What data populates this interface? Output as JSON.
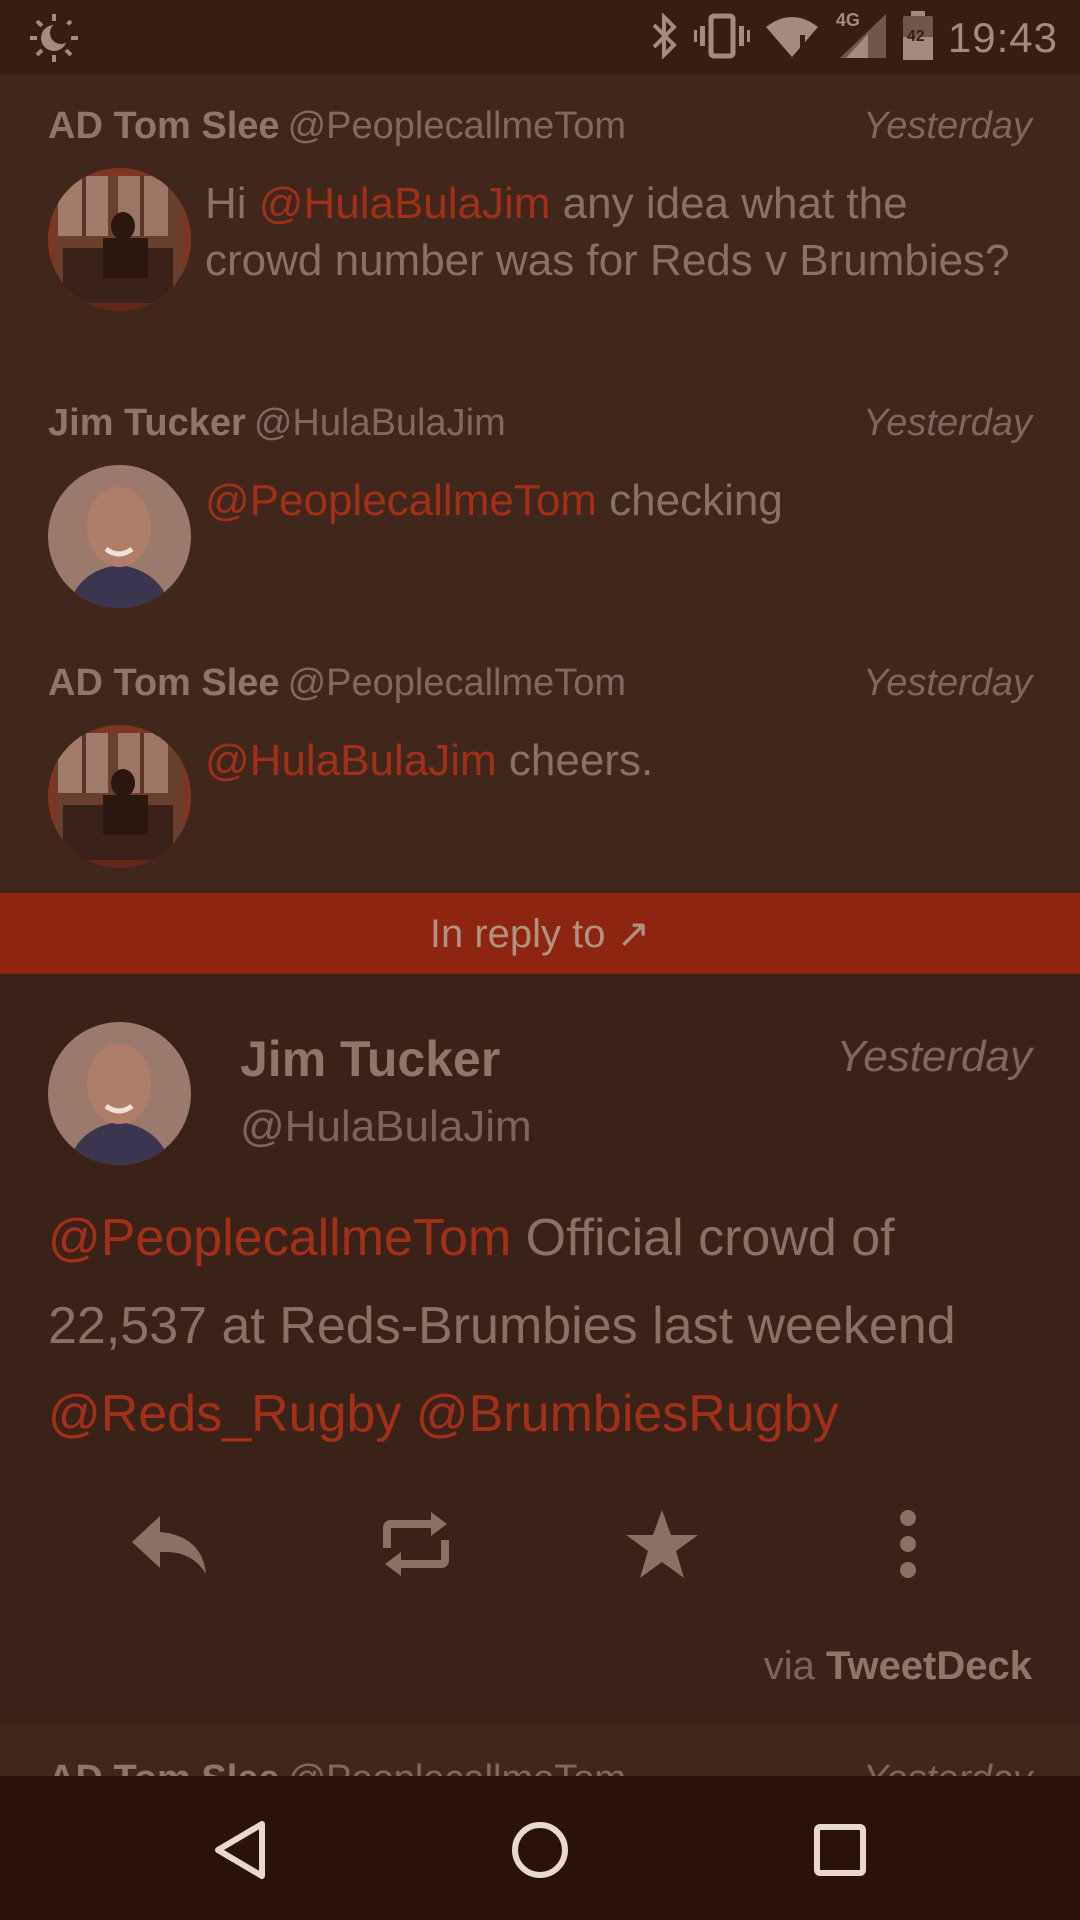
{
  "status_bar": {
    "time": "19:43",
    "battery_level": "42",
    "network": "4G",
    "icons": [
      "night-mode-icon",
      "bluetooth-icon",
      "vibrate-icon",
      "wifi-icon",
      "signal-icon",
      "battery-icon"
    ]
  },
  "thread": [
    {
      "name": "AD Tom Slee",
      "handle": "@PeoplecallmeTom",
      "time": "Yesterday",
      "segments": [
        {
          "text": "Hi ",
          "mention": false
        },
        {
          "text": "@HulaBulaJim",
          "mention": true
        },
        {
          "text": " any idea what the crowd number was for Reds v Brumbies?",
          "mention": false
        }
      ]
    },
    {
      "name": "Jim Tucker",
      "handle": "@HulaBulaJim",
      "time": "Yesterday",
      "segments": [
        {
          "text": "@PeoplecallmeTom",
          "mention": true
        },
        {
          "text": " checking",
          "mention": false
        }
      ]
    },
    {
      "name": "AD Tom Slee",
      "handle": "@PeoplecallmeTom",
      "time": "Yesterday",
      "segments": [
        {
          "text": "@HulaBulaJim",
          "mention": true
        },
        {
          "text": " cheers.",
          "mention": false
        }
      ]
    }
  ],
  "reply_bar": {
    "label": "In reply to ↗"
  },
  "main_tweet": {
    "name": "Jim Tucker",
    "handle": "@HulaBulaJim",
    "time": "Yesterday",
    "body": {
      "m1": "@PeoplecallmeTom",
      "t1": " Official crowd of 22,537 at Reds-Brumbies last weekend ",
      "m2": "@Reds_Rugby",
      "t2": " ",
      "m3": "@BrumbiesRugby"
    },
    "actions": [
      "reply-icon",
      "retweet-icon",
      "favorite-icon",
      "more-icon"
    ],
    "via_prefix": "via",
    "via_client": "TweetDeck"
  },
  "peek_tweet": {
    "name": "AD Tom Slee",
    "handle": "@PeoplecallmeTom",
    "time": "Yesterday"
  },
  "nav_bar": [
    "back-icon",
    "home-icon",
    "recents-icon"
  ],
  "colors": {
    "background": "#40261b",
    "accent": "#8d2510",
    "mention": "#a1301a"
  }
}
